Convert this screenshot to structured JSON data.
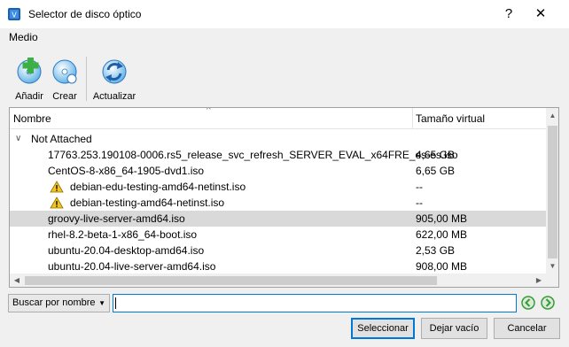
{
  "window": {
    "title": "Selector de disco óptico",
    "help": "?",
    "close": "✕"
  },
  "menu": {
    "medio": "Medio"
  },
  "toolbar": {
    "add": "Añadir",
    "create": "Crear",
    "refresh": "Actualizar"
  },
  "list": {
    "headers": {
      "name": "Nombre",
      "size": "Tamaño virtual"
    },
    "group": {
      "label": "Not Attached",
      "expanded": true
    },
    "rows": [
      {
        "name": "17763.253.190108-0006.rs5_release_svc_refresh_SERVER_EVAL_x64FRE_es-es.iso",
        "size": "4,65 GB",
        "warning": false,
        "selected": false
      },
      {
        "name": "CentOS-8-x86_64-1905-dvd1.iso",
        "size": "6,65 GB",
        "warning": false,
        "selected": false
      },
      {
        "name": "debian-edu-testing-amd64-netinst.iso",
        "size": "--",
        "warning": true,
        "selected": false
      },
      {
        "name": "debian-testing-amd64-netinst.iso",
        "size": "--",
        "warning": true,
        "selected": false
      },
      {
        "name": "groovy-live-server-amd64.iso",
        "size": "905,00 MB",
        "warning": false,
        "selected": true
      },
      {
        "name": "rhel-8.2-beta-1-x86_64-boot.iso",
        "size": "622,00 MB",
        "warning": false,
        "selected": false
      },
      {
        "name": "ubuntu-20.04-desktop-amd64.iso",
        "size": "2,53 GB",
        "warning": false,
        "selected": false
      },
      {
        "name": "ubuntu-20.04-live-server-amd64.iso",
        "size": "908,00 MB",
        "warning": false,
        "selected": false
      }
    ]
  },
  "search": {
    "mode": "Buscar por nombre",
    "value": ""
  },
  "buttons": {
    "select": "Seleccionar",
    "leave_empty": "Dejar vacío",
    "cancel": "Cancelar"
  },
  "colors": {
    "selected_row": "#d9d9d9",
    "focus_border": "#0078d7",
    "warning": "#f5c518"
  }
}
